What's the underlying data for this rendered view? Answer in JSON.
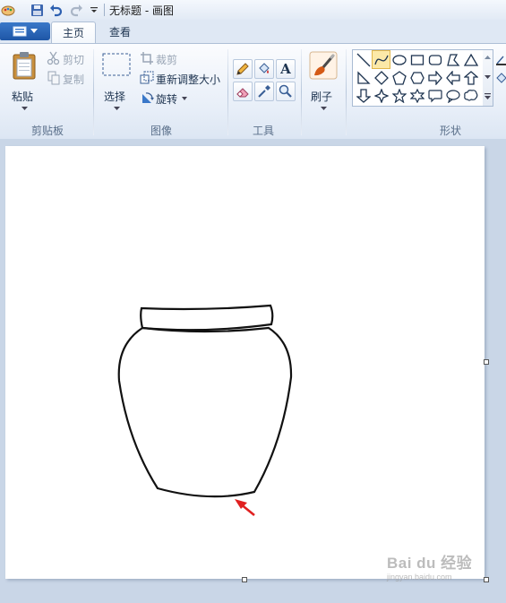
{
  "window": {
    "title": "无标题 - 画图"
  },
  "quick_access": {
    "items": [
      "paint-app-icon",
      "save-icon",
      "undo-icon",
      "redo-icon",
      "customize-dropdown-icon"
    ]
  },
  "tabs": [
    {
      "label": "主页",
      "active": true
    },
    {
      "label": "查看",
      "active": false
    }
  ],
  "ribbon": {
    "clipboard": {
      "paste_label": "粘贴",
      "cut_label": "剪切",
      "copy_label": "复制",
      "group_label": "剪贴板"
    },
    "image": {
      "select_label": "选择",
      "crop_label": "裁剪",
      "resize_label": "重新调整大小",
      "rotate_label": "旋转",
      "group_label": "图像"
    },
    "tools": {
      "group_label": "工具",
      "items": [
        "pencil-icon",
        "fill-bucket-icon",
        "text-icon",
        "eraser-icon",
        "color-picker-icon",
        "magnifier-icon"
      ],
      "text_glyph": "A"
    },
    "brushes": {
      "label": "刷子"
    },
    "shapes": {
      "group_label": "形状",
      "selected": "curve-shape"
    }
  },
  "watermark": {
    "main": "Bai du 经验",
    "sub": "jingyan.baidu.com"
  },
  "colors": {
    "accent": "#1e56a6",
    "ribbon_bg": "#e7eef8",
    "canvas": "#ffffff",
    "workspace": "#c9d6e7",
    "arrow": "#e02020"
  }
}
